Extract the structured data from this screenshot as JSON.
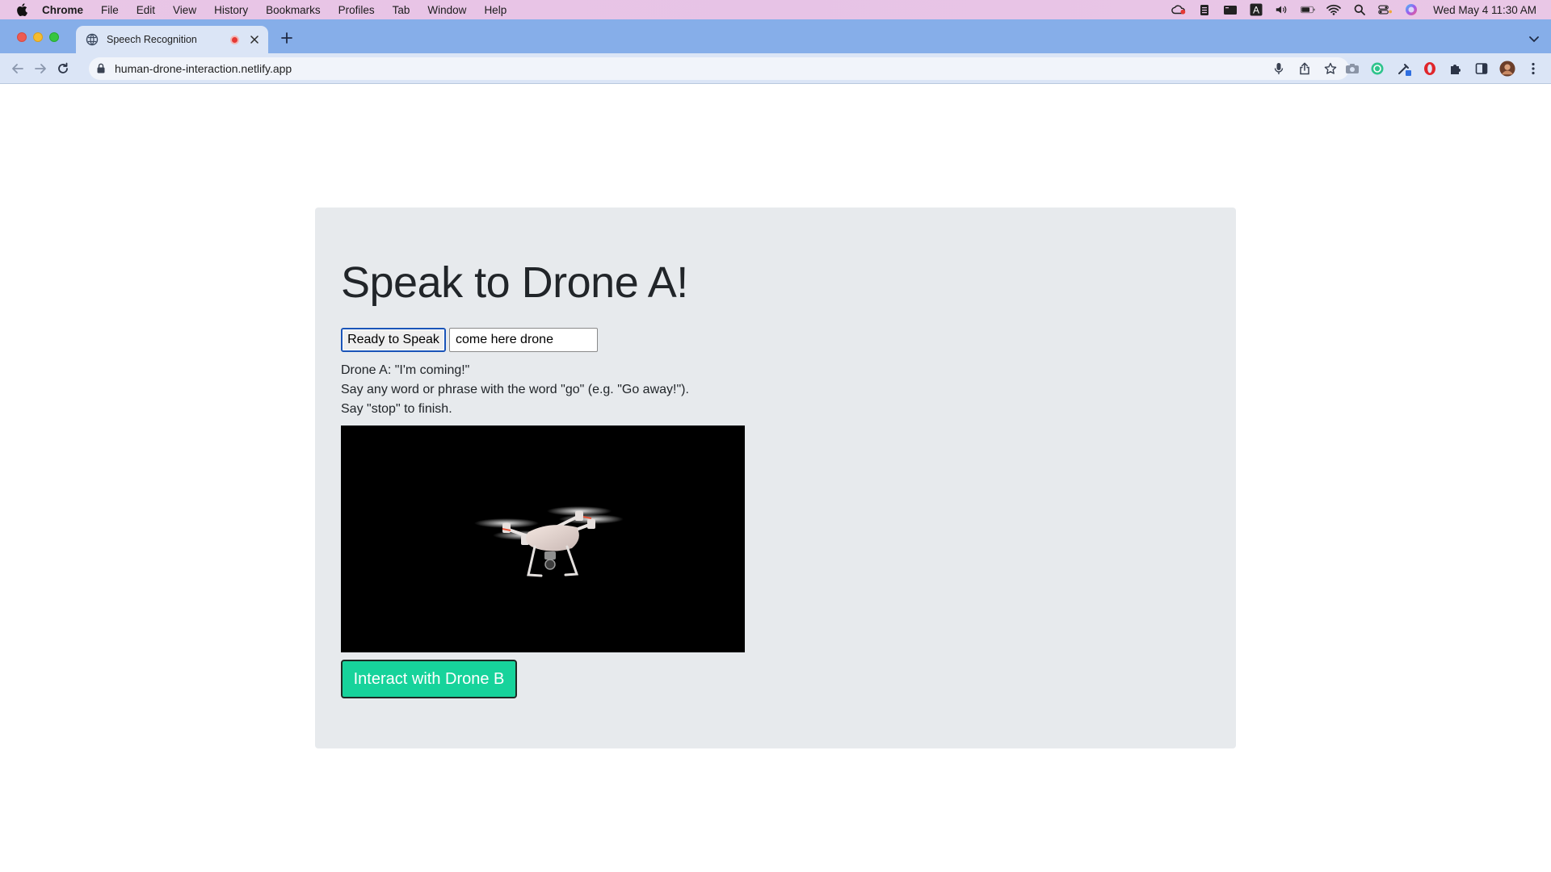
{
  "menubar": {
    "app_name": "Chrome",
    "items": [
      "File",
      "Edit",
      "View",
      "History",
      "Bookmarks",
      "Profiles",
      "Tab",
      "Window",
      "Help"
    ],
    "clock": "Wed May 4  11:30 AM"
  },
  "tab": {
    "title": "Speech Recognition",
    "recording": true
  },
  "toolbar": {
    "url": "human-drone-interaction.netlify.app"
  },
  "page": {
    "heading": "Speak to Drone A!",
    "speak_button_label": "Ready to Speak",
    "transcript_value": "come here drone",
    "info_lines": [
      "Drone A: \"I'm coming!\"",
      "Say any word or phrase with the word \"go\" (e.g. \"Go away!\").",
      "Say \"stop\" to finish."
    ],
    "video_icon": "drone-video",
    "drone_b_button_label": "Interact with Drone B",
    "accent_color": "#17d39b"
  }
}
